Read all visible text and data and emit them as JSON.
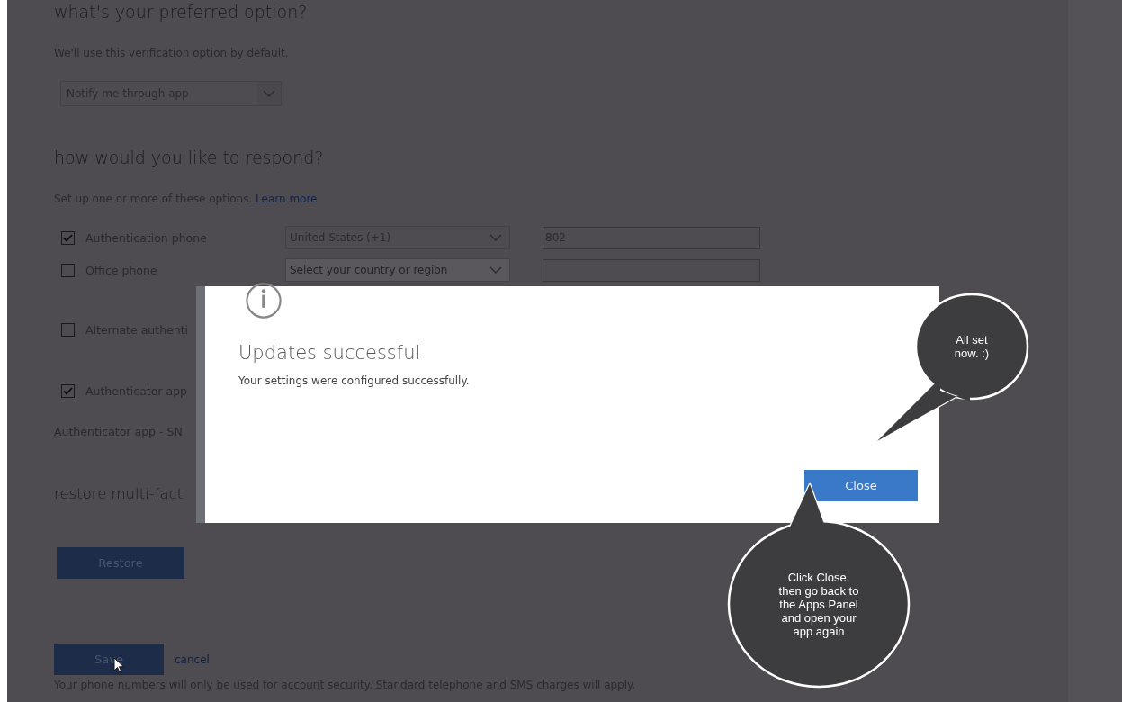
{
  "page": {
    "preferred": {
      "heading": "what's your preferred option?",
      "hint": "We'll use this verification option by default.",
      "dropdown": "Notify me through app"
    },
    "respond": {
      "heading": "how would you like to respond?",
      "hint": "Set up one or more of these options.",
      "link": "Learn more",
      "options": [
        {
          "label": "Authentication phone",
          "checked": true,
          "country": "United States (+1)",
          "phone": "802"
        },
        {
          "label": "Office phone",
          "checked": false,
          "country": "Select your country or region"
        },
        {
          "label": "Alternate authenti",
          "checked": false
        },
        {
          "label": "Authenticator app",
          "checked": true
        }
      ],
      "note": "Authenticator app - SN"
    },
    "restore": {
      "heading": "restore multi-fact",
      "button": "Restore"
    },
    "save": "Save",
    "cancel": "cancel",
    "footer": "Your phone numbers will only be used for account security. Standard telephone and SMS charges will apply."
  },
  "dialog": {
    "title": "Updates successful",
    "message": "Your settings were configured successfully.",
    "button": "Close"
  },
  "callouts": [
    {
      "text": "All set\nnow. :)"
    },
    {
      "text": "Click Close,\nthen go back to\nthe Apps Panel\nand open your\napp again"
    }
  ]
}
